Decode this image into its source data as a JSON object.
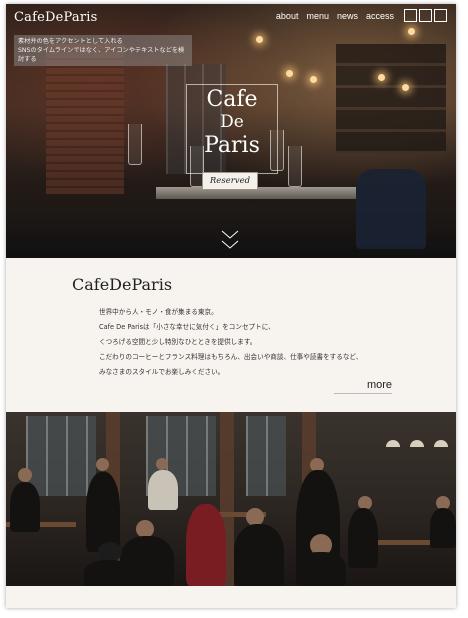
{
  "header": {
    "logo": "CafeDeParis",
    "nav": [
      "about",
      "menu",
      "news",
      "access"
    ],
    "icons": [
      "square-icon",
      "square-icon",
      "square-icon"
    ]
  },
  "hero": {
    "notice_lines": [
      "素材弁の色をアクセントとして入れる",
      "SNSのタイムラインではなく、アイコンやテキストなどを検討する"
    ],
    "title_lines": [
      "Cafe",
      "De",
      "Paris"
    ],
    "sign": "Reserved"
  },
  "about": {
    "title": "CafeDeParis",
    "lines": [
      "世界中から人・モノ・食が集まる東京。",
      "Cafe De Parisは「小さな幸せに気付く」をコンセプトに、",
      "くつろげる空間と少し特別なひとときを提供します。",
      "こだわりのコーヒーとフランス料理はもちろん、出会いや商談、仕事や読書をするなど、",
      "みなさまのスタイルでお楽しみください。"
    ],
    "more": "more"
  },
  "colors": {
    "background": "#f7f4ef",
    "text": "#222222",
    "hero_overlay": "#2a1f1a"
  }
}
